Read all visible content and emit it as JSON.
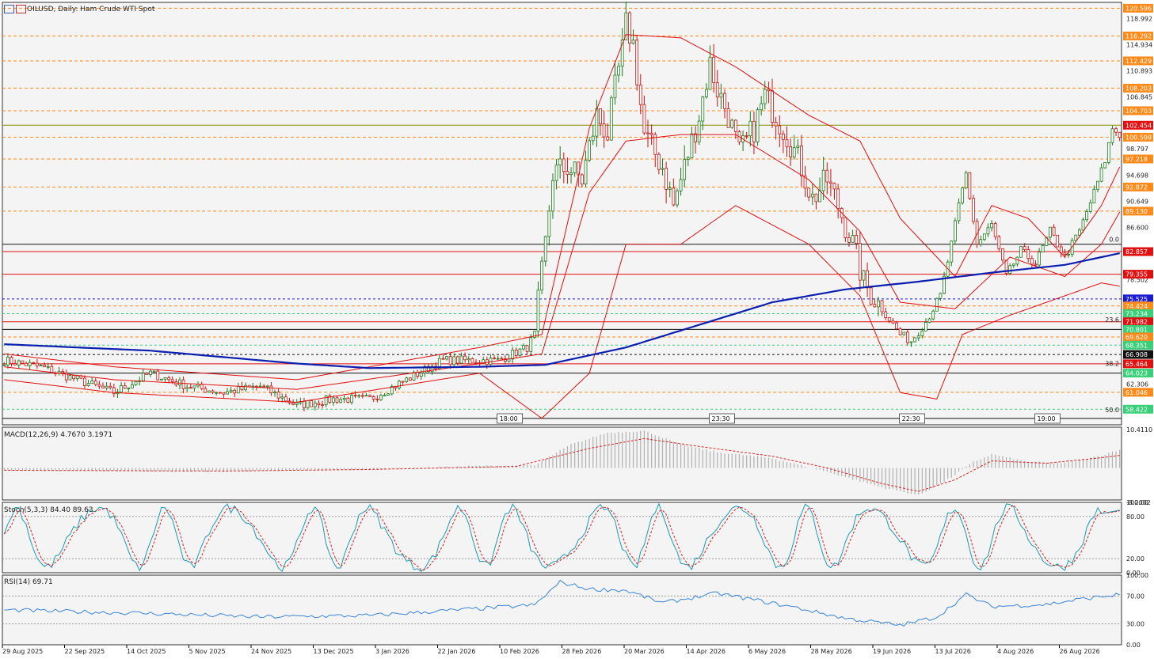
{
  "window": {
    "title": "OILUSD, Daily:  Ham Crude WTI Spot"
  },
  "toolbar": {
    "icons": [
      "chart-list-icon",
      "chart-window-icon"
    ]
  },
  "colors": {
    "background": "#f4f4f4",
    "bull_candle": "#1a7a1a",
    "bear_candle": "#cc1111",
    "bollinger": "#e01010",
    "ma_long": "#0a1fb0",
    "orange_level": "#ff8a1a",
    "macd_hist": "#b0b0b0",
    "macd_signal": "#dd2222",
    "stoch_main": "#1b9ab5",
    "stoch_signal": "#dd2222",
    "rsi": "#3a85d8"
  },
  "chart_data": [
    {
      "type": "candlestick",
      "name": "main",
      "symbol": "OILUSD",
      "timeframe": "Daily",
      "title": "OILUSD, Daily:  Ham Crude WTI Spot",
      "ylim": [
        56.0,
        121.5
      ],
      "y_ticks": [
        "118.992",
        "114.934",
        "110.893",
        "106.845",
        "98.797",
        "94.698",
        "90.649",
        "86.600",
        "78.502",
        "62.306"
      ],
      "x_ticks": [
        "29 Aug 2025",
        "22 Sep 2025",
        "14 Oct 2025",
        "5 Nov 2025",
        "24 Nov 2025",
        "13 Dec 2025",
        "3 Jan 2026",
        "22 Jan 2026",
        "10 Feb 2026",
        "28 Feb 2026",
        "20 Mar 2026",
        "14 Apr 2026",
        "6 May 2026",
        "28 May 2026",
        "19 Jun 2026",
        "13 Jul 2026",
        "4 Aug 2026",
        "26 Aug 2026"
      ],
      "price_labels": [
        {
          "text": "120.596",
          "value": 120.596,
          "bg": "#ff8a1a"
        },
        {
          "text": "116.292",
          "value": 116.292,
          "bg": "#ff8a1a"
        },
        {
          "text": "112.429",
          "value": 112.429,
          "bg": "#ff8a1a"
        },
        {
          "text": "108.203",
          "value": 108.203,
          "bg": "#ff8a1a"
        },
        {
          "text": "104.703",
          "value": 104.703,
          "bg": "#ff8a1a"
        },
        {
          "text": "102.454",
          "value": 102.454,
          "bg": "#e01010"
        },
        {
          "text": "100.598",
          "value": 100.598,
          "bg": "#ff8a1a"
        },
        {
          "text": "97.218",
          "value": 97.218,
          "bg": "#ff8a1a"
        },
        {
          "text": "92.872",
          "value": 92.872,
          "bg": "#ff8a1a"
        },
        {
          "text": "89.130",
          "value": 89.13,
          "bg": "#ff8a1a"
        },
        {
          "text": "82.857",
          "value": 82.857,
          "bg": "#e01010"
        },
        {
          "text": "79.355",
          "value": 79.355,
          "bg": "#e01010"
        },
        {
          "text": "75.525",
          "value": 75.525,
          "bg": "#1a1ad0"
        },
        {
          "text": "74.424",
          "value": 74.424,
          "bg": "#ff8a1a"
        },
        {
          "text": "73.234",
          "value": 73.234,
          "bg": "#3ad07a"
        },
        {
          "text": "71.982",
          "value": 71.982,
          "bg": "#e01010"
        },
        {
          "text": "70.801",
          "value": 70.801,
          "bg": "#3ad07a"
        },
        {
          "text": "69.620",
          "value": 69.62,
          "bg": "#ff8a1a"
        },
        {
          "text": "68.351",
          "value": 68.351,
          "bg": "#3ad07a"
        },
        {
          "text": "66.908",
          "value": 66.908,
          "bg": "#111111"
        },
        {
          "text": "65.464",
          "value": 65.464,
          "bg": "#e01010"
        },
        {
          "text": "64.023",
          "value": 64.023,
          "bg": "#3ad07a"
        },
        {
          "text": "61.046",
          "value": 61.046,
          "bg": "#ff8a1a"
        },
        {
          "text": "58.422",
          "value": 58.422,
          "bg": "#3ad07a"
        }
      ],
      "horizontal_levels": [
        {
          "value": 120.596,
          "style": "orange-dash"
        },
        {
          "value": 116.292,
          "style": "orange-dash"
        },
        {
          "value": 112.429,
          "style": "orange-dash"
        },
        {
          "value": 108.203,
          "style": "orange-dash"
        },
        {
          "value": 104.703,
          "style": "orange-dash"
        },
        {
          "value": 102.454,
          "style": "olive-solid"
        },
        {
          "value": 100.598,
          "style": "orange-dash"
        },
        {
          "value": 97.218,
          "style": "orange-dash"
        },
        {
          "value": 92.872,
          "style": "orange-dash"
        },
        {
          "value": 89.13,
          "style": "orange-dash"
        },
        {
          "value": 84.0,
          "style": "black-solid"
        },
        {
          "value": 82.857,
          "style": "red-solid"
        },
        {
          "value": 79.355,
          "style": "red-solid"
        },
        {
          "value": 75.525,
          "style": "blue-dash"
        },
        {
          "value": 74.424,
          "style": "orange-dash"
        },
        {
          "value": 73.234,
          "style": "green-dash"
        },
        {
          "value": 71.982,
          "style": "red-solid"
        },
        {
          "value": 70.801,
          "style": "black-solid"
        },
        {
          "value": 69.62,
          "style": "orange-dash"
        },
        {
          "value": 68.351,
          "style": "green-dash"
        },
        {
          "value": 66.908,
          "style": "black-dash"
        },
        {
          "value": 65.464,
          "style": "red-solid"
        },
        {
          "value": 64.023,
          "style": "black-solid"
        },
        {
          "value": 61.046,
          "style": "orange-dash"
        },
        {
          "value": 58.422,
          "style": "green-dash"
        },
        {
          "value": 57.0,
          "style": "black-solid"
        }
      ],
      "fib_labels": [
        {
          "text": "0.0",
          "value": 84.0
        },
        {
          "text": "23.6",
          "value": 71.6
        },
        {
          "text": "38.2",
          "value": 64.8
        },
        {
          "text": "50.0",
          "value": 57.6
        }
      ],
      "time_markers": [
        "18:00",
        "23:30",
        "22:30",
        "19:00"
      ],
      "close_anchors": [
        [
          0,
          66
        ],
        [
          10,
          65
        ],
        [
          25,
          62
        ],
        [
          30,
          61
        ],
        [
          40,
          64
        ],
        [
          50,
          62
        ],
        [
          60,
          61
        ],
        [
          70,
          62
        ],
        [
          80,
          59
        ],
        [
          90,
          60
        ],
        [
          100,
          60
        ],
        [
          110,
          63
        ],
        [
          120,
          66
        ],
        [
          135,
          66
        ],
        [
          143,
          68
        ],
        [
          145,
          70
        ],
        [
          148,
          84
        ],
        [
          150,
          95
        ],
        [
          154,
          96
        ],
        [
          158,
          94
        ],
        [
          162,
          104
        ],
        [
          165,
          101
        ],
        [
          167,
          108
        ],
        [
          169,
          114
        ],
        [
          170,
          118
        ],
        [
          172,
          115
        ],
        [
          175,
          101
        ],
        [
          180,
          96
        ],
        [
          183,
          90
        ],
        [
          186,
          96
        ],
        [
          190,
          104
        ],
        [
          193,
          112
        ],
        [
          195,
          108
        ],
        [
          198,
          104
        ],
        [
          201,
          98
        ],
        [
          205,
          102
        ],
        [
          208,
          107
        ],
        [
          211,
          104
        ],
        [
          214,
          101
        ],
        [
          218,
          96
        ],
        [
          221,
          91
        ],
        [
          225,
          94
        ],
        [
          228,
          90
        ],
        [
          232,
          84
        ],
        [
          235,
          78
        ],
        [
          240,
          74
        ],
        [
          245,
          70
        ],
        [
          248,
          69
        ],
        [
          252,
          72
        ],
        [
          256,
          76
        ],
        [
          259,
          84
        ],
        [
          261,
          90
        ],
        [
          263,
          95
        ],
        [
          266,
          84
        ],
        [
          270,
          87
        ],
        [
          274,
          79
        ],
        [
          278,
          83
        ],
        [
          282,
          81
        ],
        [
          286,
          86
        ],
        [
          290,
          82
        ],
        [
          294,
          86
        ],
        [
          298,
          92
        ],
        [
          301,
          97
        ],
        [
          303,
          102
        ],
        [
          305,
          101
        ]
      ],
      "ma_long": [
        [
          0,
          68.5
        ],
        [
          40,
          67.5
        ],
        [
          80,
          65.5
        ],
        [
          100,
          64.8
        ],
        [
          130,
          65
        ],
        [
          148,
          65.3
        ],
        [
          170,
          68
        ],
        [
          190,
          71.5
        ],
        [
          210,
          75
        ],
        [
          230,
          77
        ],
        [
          250,
          78.2
        ],
        [
          270,
          79.6
        ],
        [
          290,
          80.8
        ],
        [
          305,
          82.6
        ]
      ],
      "bb_upper": [
        [
          0,
          67
        ],
        [
          30,
          65
        ],
        [
          80,
          63
        ],
        [
          130,
          68
        ],
        [
          147,
          70
        ],
        [
          160,
          102
        ],
        [
          170,
          116.5
        ],
        [
          185,
          116
        ],
        [
          200,
          111.5
        ],
        [
          220,
          104
        ],
        [
          234,
          100
        ],
        [
          245,
          88
        ],
        [
          260,
          79
        ],
        [
          270,
          90
        ],
        [
          280,
          88
        ],
        [
          290,
          82
        ],
        [
          300,
          90
        ],
        [
          305,
          96
        ]
      ],
      "bb_mid": [
        [
          0,
          65
        ],
        [
          30,
          63
        ],
        [
          80,
          61.5
        ],
        [
          130,
          65.5
        ],
        [
          147,
          67
        ],
        [
          160,
          92
        ],
        [
          170,
          100
        ],
        [
          185,
          101
        ],
        [
          200,
          101
        ],
        [
          220,
          94
        ],
        [
          234,
          86
        ],
        [
          245,
          75
        ],
        [
          260,
          74
        ],
        [
          275,
          82
        ],
        [
          290,
          79
        ],
        [
          300,
          84
        ],
        [
          305,
          89
        ]
      ],
      "bb_lower": [
        [
          0,
          63
        ],
        [
          30,
          61
        ],
        [
          80,
          59.5
        ],
        [
          130,
          64
        ],
        [
          147,
          57
        ],
        [
          160,
          64
        ],
        [
          170,
          84
        ],
        [
          185,
          84
        ],
        [
          200,
          90
        ],
        [
          220,
          84
        ],
        [
          234,
          76
        ],
        [
          245,
          61
        ],
        [
          255,
          60
        ],
        [
          262,
          70
        ],
        [
          275,
          73
        ],
        [
          290,
          76
        ],
        [
          300,
          78
        ],
        [
          305,
          77.5
        ]
      ]
    },
    {
      "type": "macd",
      "name": "MACD(12,26,9)",
      "label": "MACD(12,26,9) 4.7670 3.1971",
      "params": [
        12,
        26,
        9
      ],
      "main": 4.767,
      "signal": 3.1971,
      "ylim": [
        -8.2002,
        10.411
      ],
      "y_ticks": [
        "10.4110",
        "-8.2002"
      ],
      "hist_anchors": [
        [
          0,
          -0.6
        ],
        [
          60,
          -0.9
        ],
        [
          100,
          -0.3
        ],
        [
          130,
          0.5
        ],
        [
          145,
          0.6
        ],
        [
          155,
          6
        ],
        [
          165,
          9
        ],
        [
          175,
          9.5
        ],
        [
          185,
          6
        ],
        [
          195,
          4
        ],
        [
          210,
          2.5
        ],
        [
          225,
          -1
        ],
        [
          240,
          -5
        ],
        [
          250,
          -7
        ],
        [
          258,
          -3
        ],
        [
          265,
          1.5
        ],
        [
          270,
          3.5
        ],
        [
          280,
          1.5
        ],
        [
          290,
          1.2
        ],
        [
          300,
          3.2
        ],
        [
          305,
          4.8
        ]
      ],
      "signal_anchors": [
        [
          0,
          -0.6
        ],
        [
          60,
          -0.8
        ],
        [
          100,
          -0.4
        ],
        [
          140,
          0.4
        ],
        [
          160,
          5
        ],
        [
          175,
          7.5
        ],
        [
          190,
          5.5
        ],
        [
          210,
          3
        ],
        [
          225,
          0
        ],
        [
          240,
          -4
        ],
        [
          250,
          -6
        ],
        [
          260,
          -3
        ],
        [
          270,
          1.8
        ],
        [
          285,
          1.2
        ],
        [
          300,
          2.6
        ],
        [
          305,
          3.2
        ]
      ]
    },
    {
      "type": "stochastic",
      "name": "Stoch(5,3,3)",
      "label": "Stoch(5,3,3) 84.40 89.63",
      "params": [
        5,
        3,
        3
      ],
      "main": 84.4,
      "signal": 89.63,
      "ylim": [
        0,
        100
      ],
      "y_ticks": [
        "100.00",
        "80.00",
        "20.00",
        "0.00"
      ]
    },
    {
      "type": "rsi",
      "name": "RSI(14)",
      "label": "RSI(14) 69.71",
      "params": [
        14
      ],
      "value": 69.71,
      "ylim": [
        0,
        100
      ],
      "y_ticks": [
        "100.00",
        "70.00",
        "30.00",
        "0.00"
      ],
      "rsi_anchors": [
        [
          0,
          50
        ],
        [
          40,
          45
        ],
        [
          70,
          40
        ],
        [
          100,
          42
        ],
        [
          130,
          52
        ],
        [
          145,
          57
        ],
        [
          152,
          90
        ],
        [
          160,
          80
        ],
        [
          170,
          78
        ],
        [
          180,
          60
        ],
        [
          195,
          74
        ],
        [
          215,
          55
        ],
        [
          230,
          38
        ],
        [
          245,
          28
        ],
        [
          255,
          40
        ],
        [
          263,
          72
        ],
        [
          270,
          55
        ],
        [
          285,
          58
        ],
        [
          295,
          66
        ],
        [
          305,
          72
        ]
      ]
    }
  ]
}
